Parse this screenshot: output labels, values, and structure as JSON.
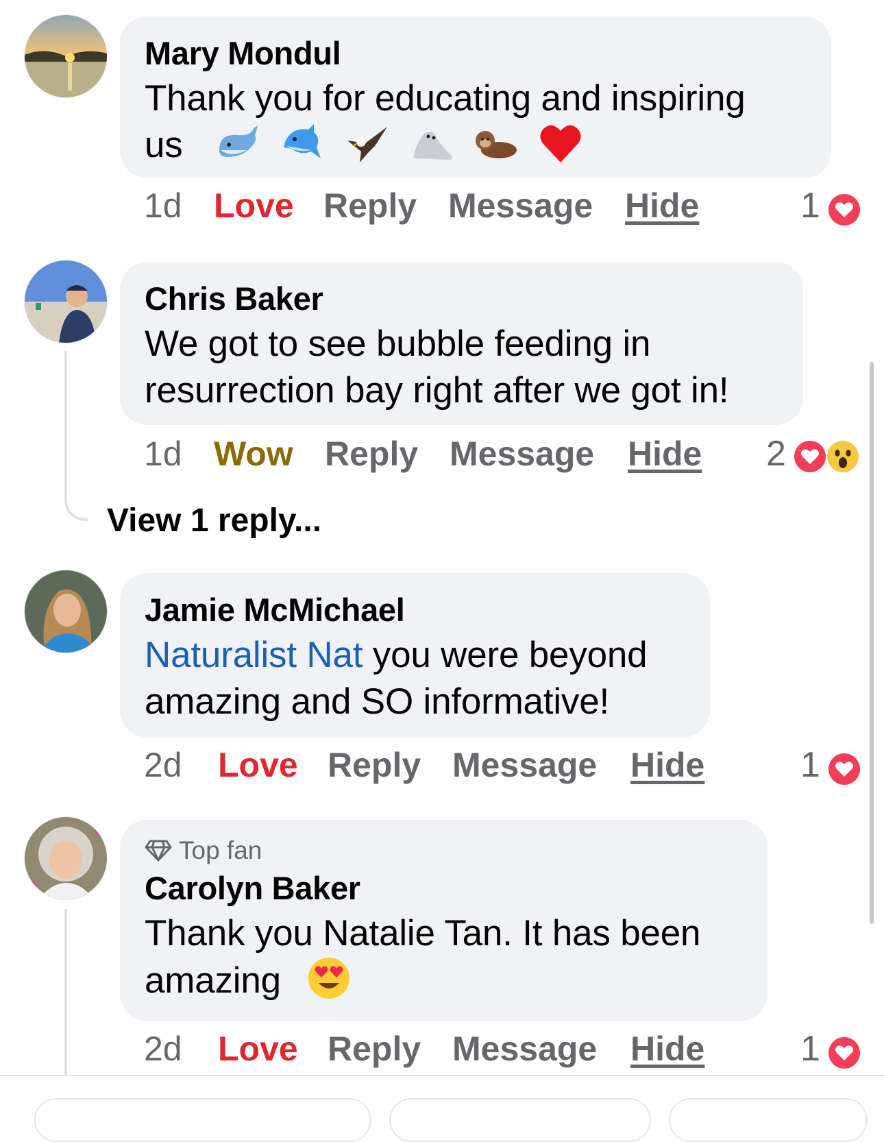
{
  "comments": [
    {
      "author": "Mary Mondul",
      "text": "Thank you  for educating and inspiring",
      "text_line2": "us",
      "emojis": [
        "whale",
        "dolphin",
        "eagle",
        "seal",
        "otter",
        "red-heart"
      ],
      "time": "1d",
      "reaction_label": "Love",
      "reply": "Reply",
      "message": "Message",
      "hide": "Hide",
      "reaction_count": "1",
      "reaction_icons": [
        "love"
      ]
    },
    {
      "author": "Chris Baker",
      "text": "We got to see bubble feeding in resurrection bay right after we got in!",
      "time": "1d",
      "reaction_label": "Wow",
      "reply": "Reply",
      "message": "Message",
      "hide": "Hide",
      "reaction_count": "2",
      "reaction_icons": [
        "love",
        "wow"
      ],
      "view_replies": "View 1 reply..."
    },
    {
      "author": "Jamie McMichael",
      "mention": "Naturalist Nat",
      "text": " you were beyond amazing and SO informative!",
      "time": "2d",
      "reaction_label": "Love",
      "reply": "Reply",
      "message": "Message",
      "hide": "Hide",
      "reaction_count": "1",
      "reaction_icons": [
        "love"
      ]
    },
    {
      "badge": "Top fan",
      "badge_icon": "diamond-icon",
      "author": "Carolyn Baker",
      "text": "Thank you Natalie Tan.  It has been",
      "text_line2": "amazing",
      "emojis": [
        "heart-eyes"
      ],
      "time": "2d",
      "reaction_label": "Love",
      "reply": "Reply",
      "message": "Message",
      "hide": "Hide",
      "reaction_count": "1",
      "reaction_icons": [
        "love"
      ]
    }
  ],
  "colors": {
    "bubble": "#f0f2f5",
    "love": "#e0262f",
    "wow": "#8c6b04",
    "muted": "#65676b",
    "mention": "#1a5fb4"
  }
}
